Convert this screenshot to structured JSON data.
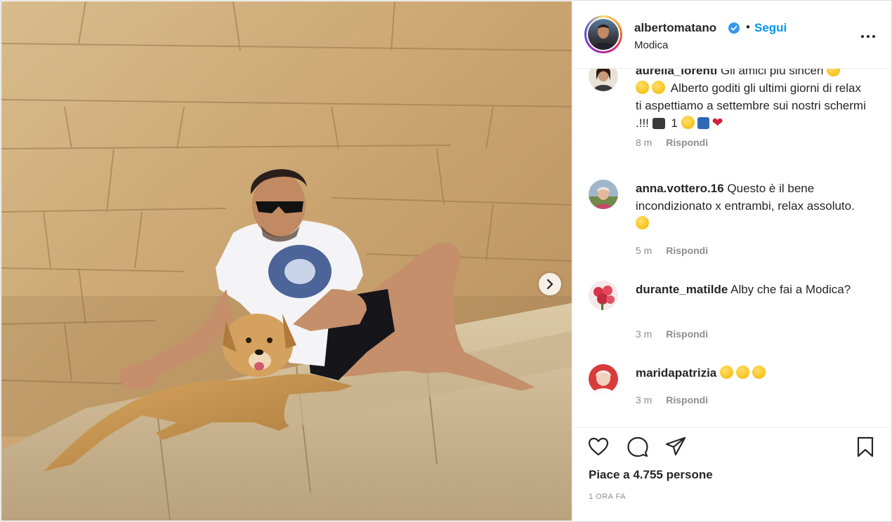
{
  "post": {
    "username": "albertomatano",
    "separator": "•",
    "follow_label": "Segui",
    "location": "Modica"
  },
  "comments": [
    {
      "username": "aurelia_lorenti",
      "text": "Gli amici più sinceri",
      "text_line2": "Alberto goditi gli ultimi giorni di relax ti aspettiamo a settembre sui nostri schermi .!!!",
      "inline_number": "1",
      "time": "8 m",
      "reply_label": "Rispondi"
    },
    {
      "username": "anna.vottero.16",
      "text": "Questo è il bene incondizionato x entrambi, relax assoluto.",
      "time": "5 m",
      "reply_label": "Rispondi"
    },
    {
      "username": "durante_matilde",
      "text": "Alby che fai a Modica?",
      "time": "3 m",
      "reply_label": "Rispondi"
    },
    {
      "username": "maridapatrizia",
      "text": "",
      "time": "3 m",
      "reply_label": "Rispondi"
    }
  ],
  "footer": {
    "likes_text": "Piace a 4.755 persone",
    "time_ago": "1 ORA FA"
  },
  "icons": {
    "like": "heart-icon",
    "comment": "comment-icon",
    "share": "send-icon",
    "save": "bookmark-icon",
    "verified": "verified-badge-icon",
    "more": "more-options-icon",
    "next": "chevron-right-icon"
  },
  "colors": {
    "accent": "#0095f6",
    "text": "#262626",
    "muted": "#8e8e8e",
    "verified": "#3897f0"
  }
}
